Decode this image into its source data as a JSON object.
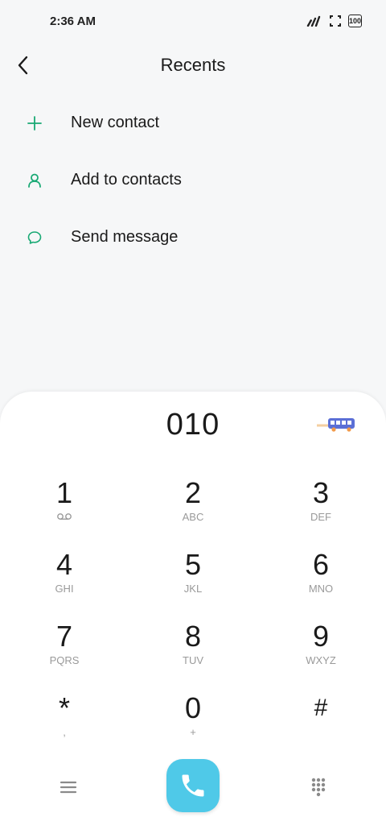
{
  "status": {
    "time": "2:36 AM",
    "battery": "100"
  },
  "header": {
    "title": "Recents"
  },
  "actions": [
    {
      "label": "New contact",
      "icon": "plus-icon"
    },
    {
      "label": "Add to contacts",
      "icon": "person-icon"
    },
    {
      "label": "Send message",
      "icon": "chat-bubble-icon"
    }
  ],
  "dialer": {
    "number": "010",
    "keys": [
      {
        "digit": "1",
        "sub": ""
      },
      {
        "digit": "2",
        "sub": "ABC"
      },
      {
        "digit": "3",
        "sub": "DEF"
      },
      {
        "digit": "4",
        "sub": "GHI"
      },
      {
        "digit": "5",
        "sub": "JKL"
      },
      {
        "digit": "6",
        "sub": "MNO"
      },
      {
        "digit": "7",
        "sub": "PQRS"
      },
      {
        "digit": "8",
        "sub": "TUV"
      },
      {
        "digit": "9",
        "sub": "WXYZ"
      },
      {
        "digit": "*",
        "sub": ","
      },
      {
        "digit": "0",
        "sub": "+"
      },
      {
        "digit": "#",
        "sub": ""
      }
    ]
  },
  "colors": {
    "accent": "#19a974",
    "call_button": "#4fc9e8"
  }
}
